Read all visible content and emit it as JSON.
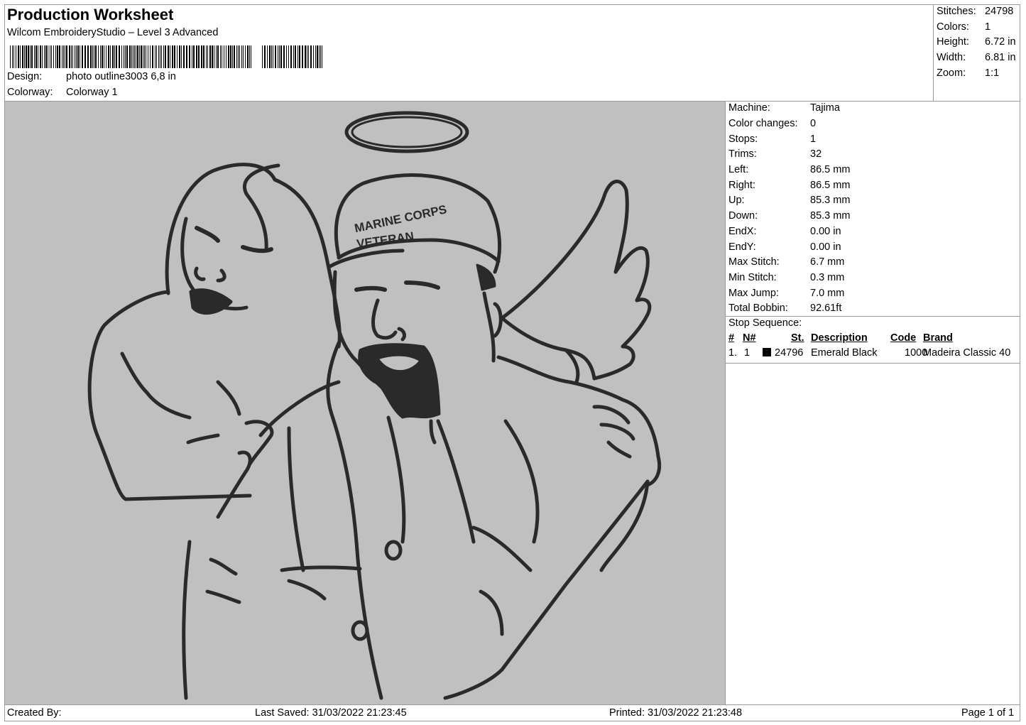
{
  "header": {
    "title": "Production Worksheet",
    "software": "Wilcom EmbroideryStudio – Level 3 Advanced",
    "design_label": "Design:",
    "design_value": "photo outline3003 6,8 in",
    "colorway_label": "Colorway:",
    "colorway_value": "Colorway 1"
  },
  "top_stats": [
    {
      "label": "Stitches:",
      "value": "24798"
    },
    {
      "label": "Colors:",
      "value": "1"
    },
    {
      "label": "Height:",
      "value": "6.72 in"
    },
    {
      "label": "Width:",
      "value": "6.81 in"
    },
    {
      "label": "Zoom:",
      "value": "1:1"
    }
  ],
  "machine_stats": [
    {
      "label": "Machine:",
      "value": "Tajima"
    },
    {
      "label": "Color changes:",
      "value": "0"
    },
    {
      "label": "Stops:",
      "value": "1"
    },
    {
      "label": "Trims:",
      "value": "32"
    },
    {
      "label": "Left:",
      "value": "86.5 mm"
    },
    {
      "label": "Right:",
      "value": "86.5 mm"
    },
    {
      "label": "Up:",
      "value": "85.3 mm"
    },
    {
      "label": "Down:",
      "value": "85.3 mm"
    },
    {
      "label": "EndX:",
      "value": "0.00 in"
    },
    {
      "label": "EndY:",
      "value": "0.00 in"
    },
    {
      "label": "Max Stitch:",
      "value": "6.7 mm"
    },
    {
      "label": "Min Stitch:",
      "value": "0.3 mm"
    },
    {
      "label": "Max Jump:",
      "value": "7.0 mm"
    },
    {
      "label": "Total Bobbin:",
      "value": "92.61ft"
    }
  ],
  "stop_sequence": {
    "title": "Stop Sequence:",
    "columns": {
      "num": "#",
      "needle": "N#",
      "stitches": "St.",
      "description": "Description",
      "code": "Code",
      "brand": "Brand"
    },
    "rows": [
      {
        "num": "1.",
        "needle": "1",
        "color": "#000000",
        "stitches": "24796",
        "description": "Emerald Black",
        "code": "1000",
        "brand": "Madeira Classic 40"
      }
    ]
  },
  "preview": {
    "thread_color": "#2a2a2a",
    "background_color": "#c0c0c0",
    "cap_text_top": "MARINE CORPS",
    "cap_text_bottom": "VETERAN"
  },
  "footer": {
    "created_by": "Created By:",
    "last_saved": "Last Saved: 31/03/2022 21:23:45",
    "printed": "Printed: 31/03/2022 21:23:48",
    "page": "Page 1 of 1"
  }
}
